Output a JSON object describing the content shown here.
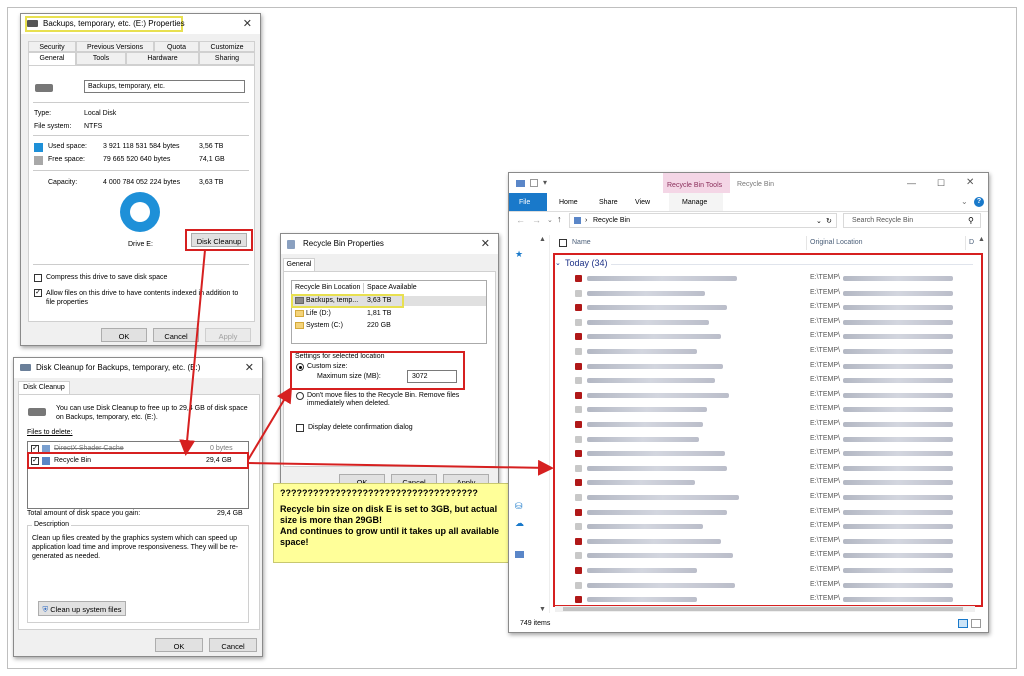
{
  "drive_properties": {
    "title": "Backups, temporary, etc. (E:) Properties",
    "tabs_row1": [
      "Security",
      "Previous Versions",
      "Quota",
      "Customize"
    ],
    "tabs_row2": [
      "General",
      "Tools",
      "Hardware",
      "Sharing"
    ],
    "volume_name": "Backups, temporary, etc.",
    "type_label": "Type:",
    "type_value": "Local Disk",
    "fs_label": "File system:",
    "fs_value": "NTFS",
    "used_label": "Used space:",
    "used_bytes": "3 921 118 531 584 bytes",
    "used_size": "3,56 TB",
    "free_label": "Free space:",
    "free_bytes": "79 665 520 640 bytes",
    "free_size": "74,1 GB",
    "capacity_label": "Capacity:",
    "capacity_bytes": "4 000 784 052 224 bytes",
    "capacity_size": "3,63 TB",
    "drive_label": "Drive E:",
    "cleanup_button": "Disk Cleanup",
    "compress_label": "Compress this drive to save disk space",
    "index_label": "Allow files on this drive to have contents indexed in addition to file properties",
    "ok": "OK",
    "cancel": "Cancel",
    "apply": "Apply",
    "colors": {
      "used": "#1e90d8",
      "free": "#a8a8a8"
    }
  },
  "disk_cleanup": {
    "title": "Disk Cleanup for Backups, temporary, etc. (E:)",
    "tab": "Disk Cleanup",
    "intro": "You can use Disk Cleanup to free up to 29,4 GB of disk space on Backups, temporary, etc. (E:).",
    "files_label": "Files to delete:",
    "items": [
      {
        "name": "DirectX Shader Cache",
        "size": "0 bytes"
      },
      {
        "name": "Recycle Bin",
        "size": "29,4 GB"
      }
    ],
    "total_label": "Total amount of disk space you gain:",
    "total_value": "29,4 GB",
    "desc_title": "Description",
    "desc_text": "Clean up files created by the graphics system which can speed up application load time and improve responsiveness. They will be re-generated as needed.",
    "system_button": "Clean up system files",
    "ok": "OK",
    "cancel": "Cancel"
  },
  "recycle_props": {
    "title": "Recycle Bin Properties",
    "tab": "General",
    "col_location": "Recycle Bin Location",
    "col_space": "Space Available",
    "locations": [
      {
        "name": "Backups, temp...",
        "space": "3,63 TB"
      },
      {
        "name": "Life (D:)",
        "space": "1,81 TB"
      },
      {
        "name": "System (C:)",
        "space": "220 GB"
      }
    ],
    "settings_label": "Settings for selected location",
    "custom_label": "Custom size:",
    "max_label": "Maximum size (MB):",
    "max_value": "3072",
    "dont_move_label": "Don't move files to the Recycle Bin. Remove files immediately when deleted.",
    "confirm_label": "Display delete confirmation dialog",
    "ok": "OK",
    "cancel": "Cancel",
    "apply": "Apply"
  },
  "note": {
    "line1": "????????????????????????????????????",
    "line2": "Recycle bin size on disk E is set to 3GB, but actual size is more than 29GB!",
    "line3": "And continues to grow until it takes up all available space!"
  },
  "explorer": {
    "tools_tab": "Recycle Bin Tools",
    "window_title": "Recycle Bin",
    "ribbon_tabs": [
      "File",
      "Home",
      "Share",
      "View",
      "Manage"
    ],
    "address": "Recycle Bin",
    "search_placeholder": "Search Recycle Bin",
    "col_name": "Name",
    "col_location": "Original Location",
    "col_date": "D",
    "group_label": "Today (34)",
    "row_location": "E:\\TEMP\\",
    "row_count": 23,
    "status": "749 items"
  }
}
